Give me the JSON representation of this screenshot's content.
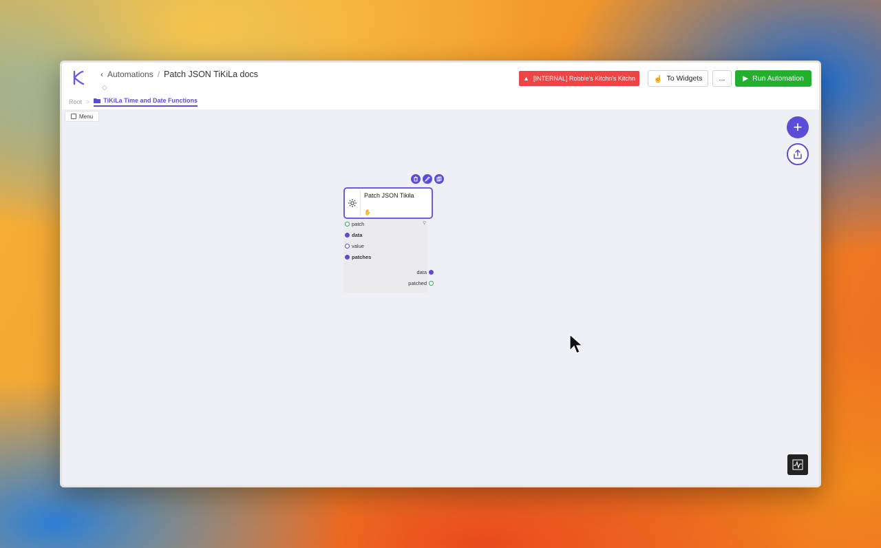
{
  "header": {
    "back_link": "Automations",
    "separator": "/",
    "current_title": "Patch JSON TiKiLa docs",
    "warning_label": "[INTERNAL] Robbie's Kitchn's Kitchn",
    "widgets_label": "To Widgets",
    "more_label": "...",
    "run_label": "Run Automation"
  },
  "subnav": {
    "root": "Root",
    "separator": ">",
    "active": "TiKiLa Time and Date Functions"
  },
  "canvas": {
    "menu_label": "Menu"
  },
  "node": {
    "title": "Patch JSON Tikila",
    "inputs": [
      {
        "label": "patch"
      },
      {
        "label": "data"
      },
      {
        "label": "value"
      },
      {
        "label": "patches"
      }
    ],
    "outputs": [
      {
        "label": "data"
      },
      {
        "label": "patched"
      }
    ]
  },
  "colors": {
    "accent": "#5b4ed6",
    "run_green": "#22b02e",
    "warning_red": "#ef4444"
  }
}
